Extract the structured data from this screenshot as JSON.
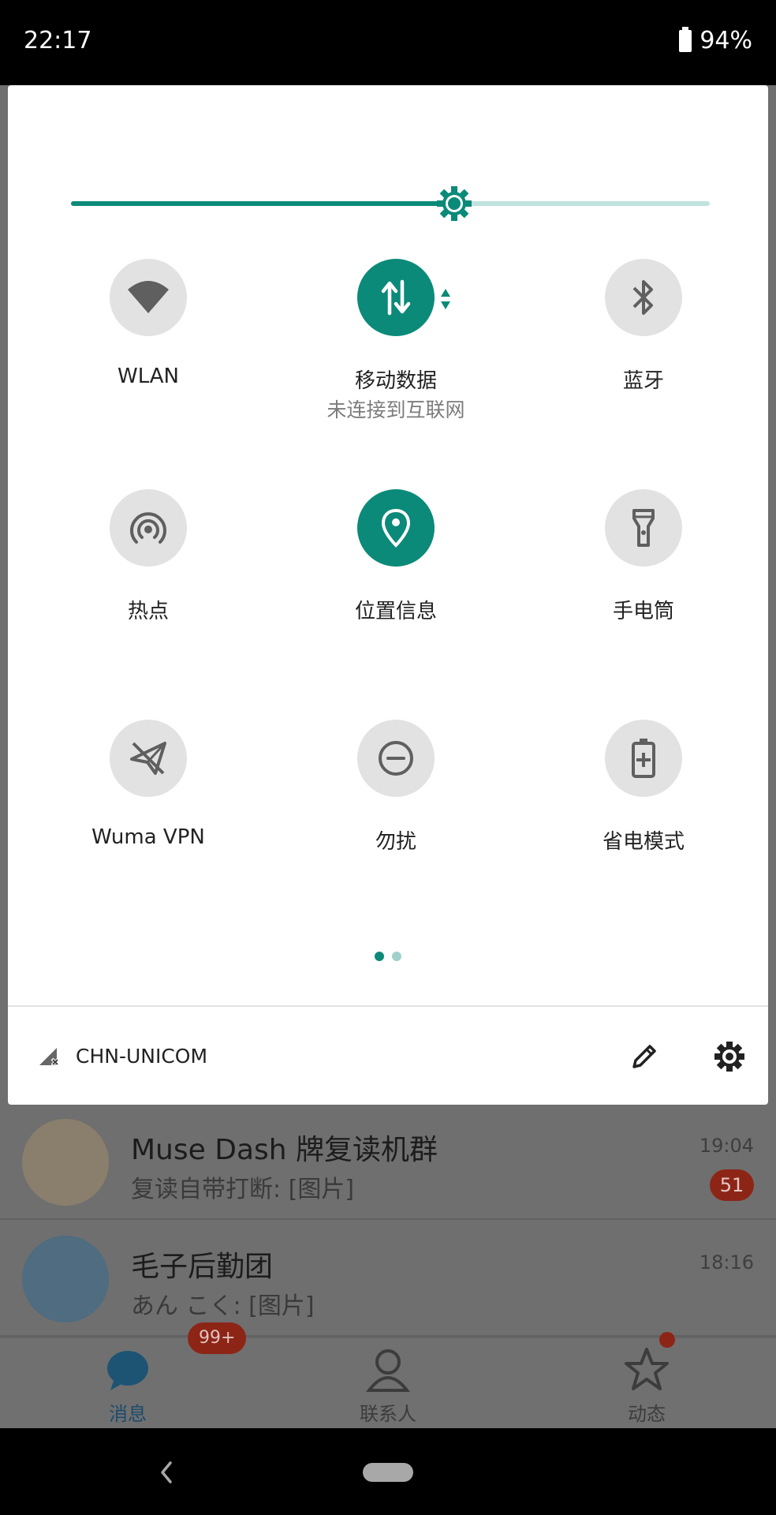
{
  "status_bar": {
    "time": "22:17",
    "battery": "94%"
  },
  "quick_settings": {
    "brightness_level": 0.6,
    "tiles": [
      {
        "label": "WLAN",
        "sub": "",
        "icon": "wifi-icon",
        "on": false
      },
      {
        "label": "移动数据",
        "sub": "未连接到互联网",
        "icon": "mobile-data-icon",
        "on": true
      },
      {
        "label": "蓝牙",
        "sub": "",
        "icon": "bluetooth-icon",
        "on": false
      },
      {
        "label": "热点",
        "sub": "",
        "icon": "hotspot-icon",
        "on": false
      },
      {
        "label": "位置信息",
        "sub": "",
        "icon": "location-icon",
        "on": true
      },
      {
        "label": "手电筒",
        "sub": "",
        "icon": "flashlight-icon",
        "on": false
      },
      {
        "label": "Wuma VPN",
        "sub": "",
        "icon": "vpn-icon",
        "on": false
      },
      {
        "label": "勿扰",
        "sub": "",
        "icon": "do-not-disturb-icon",
        "on": false
      },
      {
        "label": "省电模式",
        "sub": "",
        "icon": "battery-saver-icon",
        "on": false
      }
    ],
    "page_count": 2,
    "current_page": 1,
    "carrier": "CHN-UNICOM",
    "accent_color": "#0b8a79"
  },
  "background_app": {
    "chats": [
      {
        "title": "Muse Dash 牌复读机群",
        "preview": "复读自带打断: [图片]",
        "time": "19:04",
        "unread": "51"
      },
      {
        "title": "毛子后勤团",
        "preview": "あん こく: [图片]",
        "time": "18:16",
        "unread": ""
      }
    ],
    "tabs": [
      {
        "label": "消息",
        "badge": "99+",
        "active": true
      },
      {
        "label": "联系人",
        "badge": "",
        "active": false
      },
      {
        "label": "动态",
        "badge": "",
        "active": false
      }
    ]
  }
}
